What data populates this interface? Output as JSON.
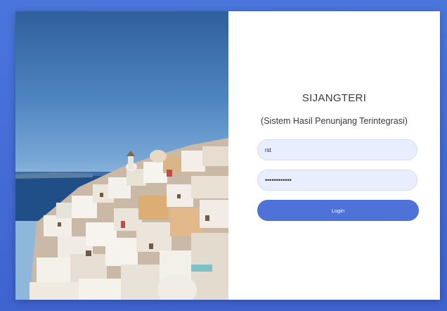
{
  "app": {
    "title": "SIJANGTERI",
    "subtitle": "(Sistem Hasil Penunjang Terintegrasi)"
  },
  "login_form": {
    "username_value": "rst",
    "password_value": "••••••••••••",
    "login_label": "Login"
  },
  "colors": {
    "background": "#4a76dc",
    "card": "#ffffff",
    "input_fill": "#e8eefd",
    "button": "#4f72d9",
    "sky": "#5b90c8",
    "sea": "#1f4f86"
  },
  "image": {
    "description_icon": "santorini-photo"
  }
}
